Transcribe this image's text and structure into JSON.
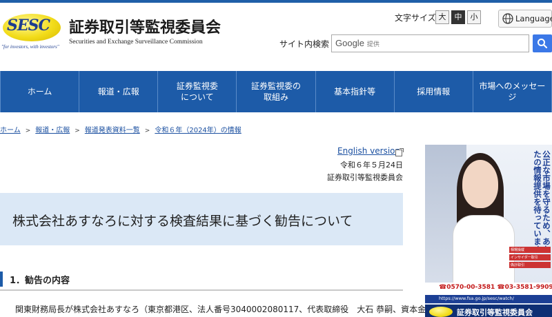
{
  "header": {
    "logo_text": "SESC",
    "logo_tagline": "\"for investors, with investors\"",
    "org_name_jp": "証券取引等監視委員会",
    "org_name_en": "Securities and Exchange Surveillance Commission",
    "font_size_label": "文字サイズ",
    "font_sizes": [
      "大",
      "中",
      "小"
    ],
    "font_size_selected": "中",
    "language_button": "Language",
    "search_label": "サイト内検索",
    "search_brand": "Google",
    "search_placeholder": "提供"
  },
  "nav": {
    "items": [
      "ホーム",
      "報道・広報",
      "証券監視委\nについて",
      "証券監視委の\n取組み",
      "基本指針等",
      "採用情報",
      "市場へのメッセージ"
    ]
  },
  "breadcrumb": {
    "items": [
      "ホーム",
      "報道・広報",
      "報道発表資料一覧",
      "令和６年（2024年）の情報"
    ],
    "separator": ">"
  },
  "article": {
    "english_link": "English version",
    "date": "令和６年５月24日",
    "issuer": "証券取引等監視委員会",
    "title": "株式会社あすなろに対する検査結果に基づく勧告について",
    "section_heading": "1．勧告の内容",
    "body_first_line": "関東財務局長が株式会社あすなろ（東京都港区、法人番号3040002080117、代表取締役　大石 恭嗣、資本金"
  },
  "poster": {
    "slogan": "公正な市場を守るため、あなたの情報提供を待っています",
    "labels": [
      "相場操縦",
      "インサイダー取引",
      "偽計取引"
    ],
    "phone": "☎0570-00-3581 ☎03-3581-9909",
    "url": "https://www.fsa.go.jp/sesc/watch/",
    "footer_logo": "SESC",
    "footer_text": "証券取引等監視委員会"
  },
  "colors": {
    "brand_blue": "#1d5ba8",
    "title_bg": "#dbe8f6",
    "link": "#1a4fa0",
    "search_button": "#3b78e7"
  }
}
